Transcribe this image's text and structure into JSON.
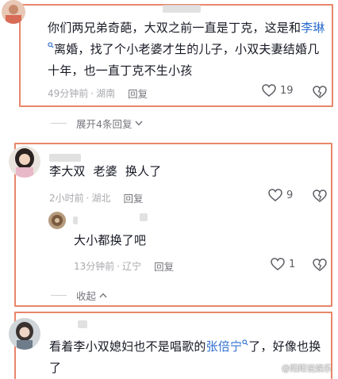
{
  "comments": [
    {
      "text_before": "你们两兄弟奇葩，大双之前一直是丁克，这是和",
      "link": "李琳",
      "text_after": "离婚，找了个小老婆才生的儿子，小双夫妻结婚几十年，也一直丁克不生小孩",
      "time": "49分钟前",
      "location": "湖南",
      "reply_label": "回复",
      "likes": "19"
    },
    {
      "text": "李大双  老婆  换人了",
      "time": "2小时前",
      "location": "湖北",
      "reply_label": "回复",
      "likes": "9"
    },
    {
      "text": "大小都换了吧",
      "time": "13分钟前",
      "location": "辽宁",
      "reply_label": "回复",
      "likes": "1"
    },
    {
      "text_before": "看着李小双媳妇也不是唱歌的",
      "link": "张倍宁",
      "text_after": "了，好像也换了"
    }
  ],
  "expand_replies": "展开4条回复",
  "collapse_label": "收起",
  "watermark": "@阳阳说娱乐",
  "colors": {
    "frame": "#e9866a",
    "link": "#2f6fcf",
    "meta": "#a8a9ad"
  }
}
